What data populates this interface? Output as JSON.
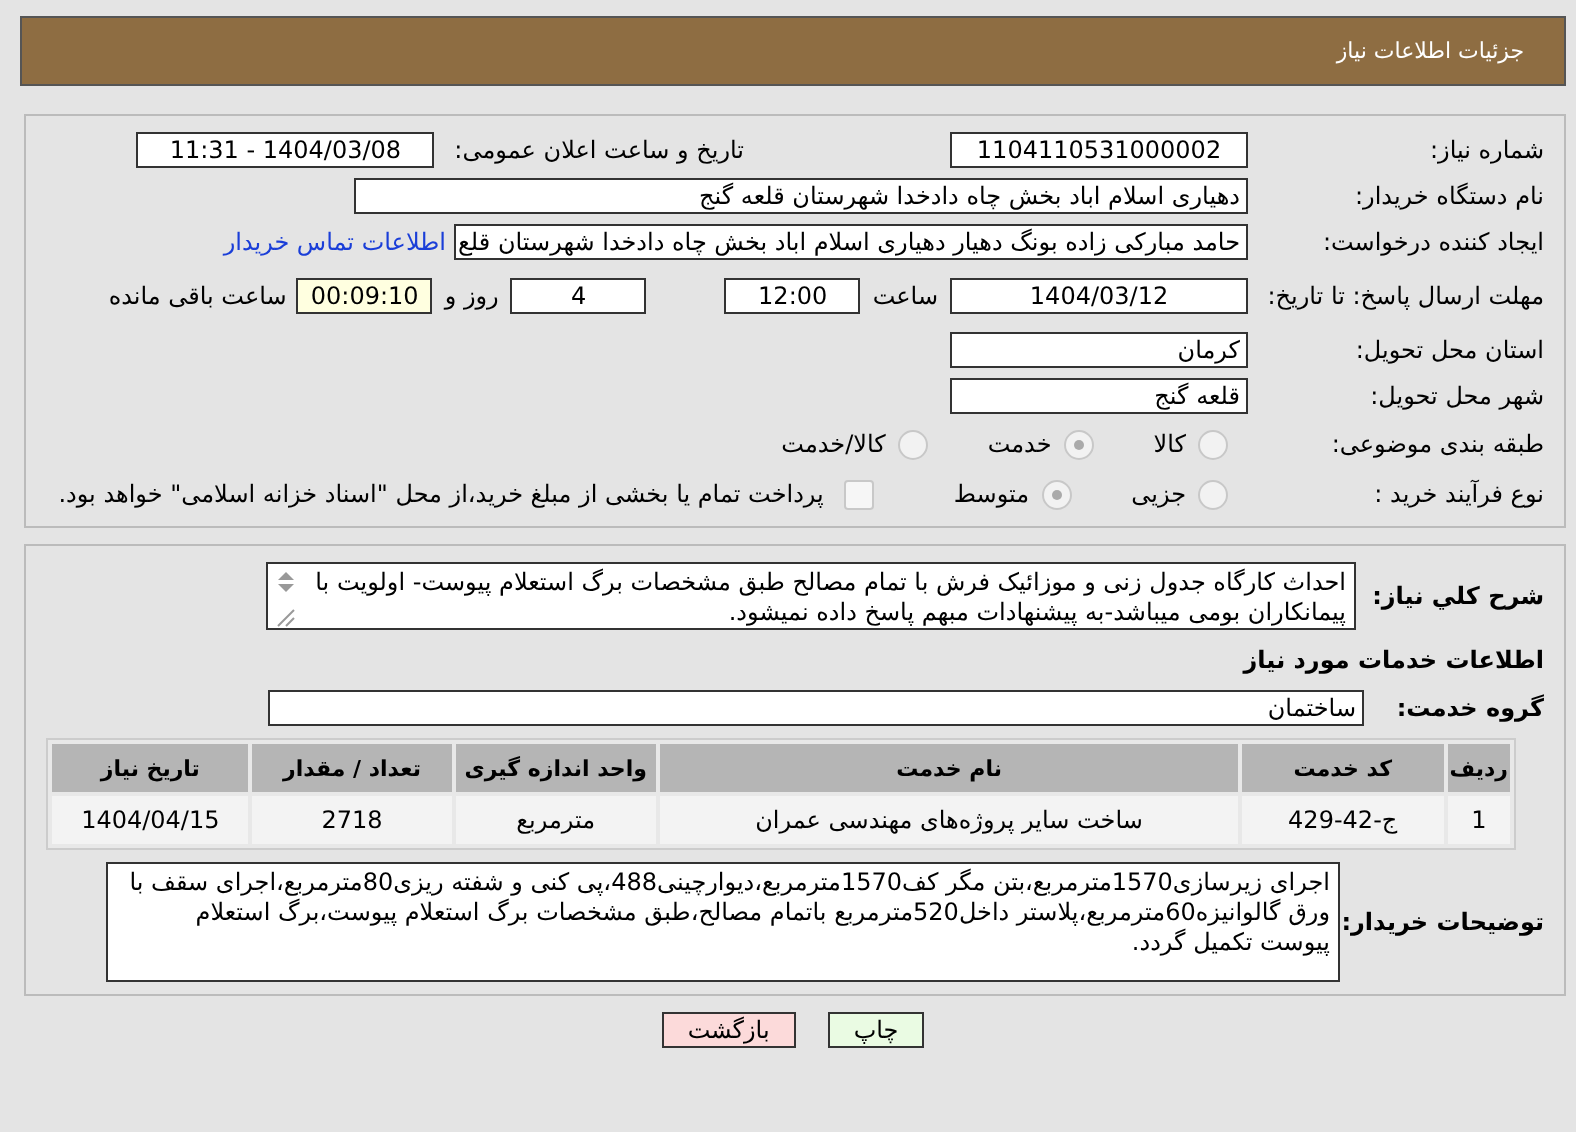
{
  "header": {
    "title": "جزئیات اطلاعات نیاز"
  },
  "need_number": {
    "label": "شماره نیاز:",
    "value": "1104110531000002"
  },
  "announce": {
    "label": "تاریخ و ساعت اعلان عمومی:",
    "value": "1404/03/08 - 11:31"
  },
  "buyer_org": {
    "label": "نام دستگاه خریدار:",
    "value": "دهیاری اسلام اباد بخش چاه دادخدا شهرستان قلعه گنج"
  },
  "creator": {
    "label": "ایجاد کننده درخواست:",
    "value": "حامد مبارکی زاده بونگ دهیار دهیاری اسلام اباد بخش چاه دادخدا شهرستان قلع",
    "link": "اطلاعات تماس خریدار"
  },
  "deadline": {
    "label": "مهلت ارسال پاسخ: تا تاریخ:",
    "date": "1404/03/12",
    "time_label": "ساعت",
    "time": "12:00",
    "days": "4",
    "days_label": "روز و",
    "remaining": "00:09:10",
    "remaining_label": "ساعت باقی مانده"
  },
  "province": {
    "label": "استان محل تحویل:",
    "value": "کرمان"
  },
  "city": {
    "label": "شهر محل تحویل:",
    "value": "قلعه گنج"
  },
  "category": {
    "label": "طبقه بندی موضوعی:",
    "options": [
      {
        "label": "کالا",
        "selected": false
      },
      {
        "label": "خدمت",
        "selected": true
      },
      {
        "label": "کالا/خدمت",
        "selected": false
      }
    ]
  },
  "process": {
    "label": "نوع فرآیند خرید :",
    "options": [
      {
        "label": "جزیی",
        "selected": false
      },
      {
        "label": "متوسط",
        "selected": true
      }
    ],
    "payment": {
      "label": "پرداخت تمام یا بخشی از مبلغ خرید،از محل \"اسناد خزانه اسلامی\" خواهد بود.",
      "checked": false
    }
  },
  "description": {
    "label": "شرح کلي نياز:",
    "value": "احداث کارگاه جدول زنی و موزائیک فرش با تمام مصالح طبق مشخصات برگ استعلام پیوست- اولویت با پیمانکاران بومی میباشد-به پیشنهادات مبهم پاسخ داده نمیشود."
  },
  "services_heading": "اطلاعات خدمات مورد نیاز",
  "service_group": {
    "label": "گروه خدمت:",
    "value": "ساختمان"
  },
  "table": {
    "columns": [
      "ردیف",
      "کد خدمت",
      "نام خدمت",
      "واحد اندازه گیری",
      "تعداد / مقدار",
      "تاریخ نیاز"
    ],
    "rows": [
      [
        "1",
        "ج-42-429",
        "ساخت سایر پروژه‌های مهندسی عمران",
        "مترمربع",
        "2718",
        "1404/04/15"
      ]
    ]
  },
  "buyer_notes": {
    "label": "توضیحات خریدار:",
    "value": "اجرای زیرسازی1570مترمربع،بتن مگر کف1570مترمربع،دیوارچینی488،پی کنی و شفته ریزی80مترمربع،اجرای سقف با ورق گالوانیزه60مترمربع،پلاستر داخل520مترمربع باتمام مصالح،طبق مشخصات برگ استعلام پیوست،برگ استعلام پیوست تکمیل گردد."
  },
  "buttons": [
    {
      "label": "چاپ",
      "kind": "print"
    },
    {
      "label": "بازگشت",
      "kind": "back"
    }
  ]
}
